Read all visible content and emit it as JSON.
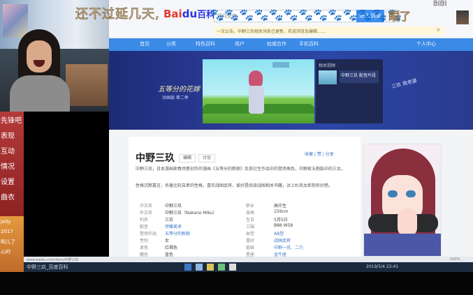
{
  "danmaku": {
    "text": "还不过延几天,",
    "emojis": "🐾🐾🐾🐾🐾🐾🐾🐾🐾🐾🐾🐾🐾",
    "text_right": "眼了",
    "corner": "BIBI"
  },
  "left_overlay": {
    "items": [
      "先锋吧",
      "表现",
      "互动",
      "情况",
      "设置",
      "曲衣"
    ],
    "lower_lines": [
      "Jelly",
      "2017",
      "明儿了",
      "心的"
    ]
  },
  "baidu": {
    "logo_text": "Bai",
    "logo_paw": "du",
    "logo_sub": "百科",
    "search_placeholder": "四月是你",
    "search_button": "进入词条",
    "notice": "一次公告，中野三玖相关词条已更新，欢迎浏览及编辑……",
    "close": "×",
    "nav": [
      "首页",
      "分类",
      "特色百科",
      "用户",
      "权威合作",
      "手机百科"
    ],
    "nav_user": "个人中心"
  },
  "banner": {
    "title": "五等分的花嫁",
    "subtitle": "动画版 第二季",
    "side_header": "相关视频",
    "side_item": "中野三玖 配音片段",
    "handwrite": "三玖 我老婆"
  },
  "article": {
    "title": "中野三玖",
    "edit": "编辑",
    "discuss": "讨论",
    "tools": "收藏  |  赞  |  分享",
    "para1": "中野三玖，日本漫画家春场葱创作的漫画《五等分的新娘》及其衍生作品中的登场角色，中野家五胞胎中的三女。",
    "para2": "性格沉默寡言，有着比较自卑的性格，喜欢战国武将，爱好是阅读战国相关书籍，对上杉风太郎抱有好感。",
    "info": [
      {
        "k1": "中文名",
        "v1": "中野三玖",
        "k2": "职业",
        "v2": "高中生"
      },
      {
        "k1": "外文名",
        "v1": "中野三玖（Nakano Miku）",
        "k2": "身高",
        "v2": "159cm"
      },
      {
        "k1": "别名",
        "v1": "三玖",
        "k2": "生日",
        "v2": "5月5日"
      },
      {
        "k1": "配音",
        "v1": "伊藤美来",
        "k2": "三围",
        "v2": "B88 W58"
      },
      {
        "k1": "登场作品",
        "v1": "五等分的新娘",
        "k2": "血型",
        "v2": "AB型"
      },
      {
        "k1": "性别",
        "v1": "女",
        "k2": "喜好",
        "v2": "战国武将"
      },
      {
        "k1": "发色",
        "v1": "红褐色",
        "k2": "姐妹",
        "v2": "中野一花、二乃"
      },
      {
        "k1": "瞳色",
        "v1": "蓝色",
        "k2": "星座",
        "v2": "金牛座"
      }
    ]
  },
  "taskbar": {
    "text": "中野三玖_百度百科",
    "clock": "2019/5/4 23:41"
  },
  "status": {
    "left": "www.baidu.com/item/中野三玖",
    "right": "100%"
  }
}
